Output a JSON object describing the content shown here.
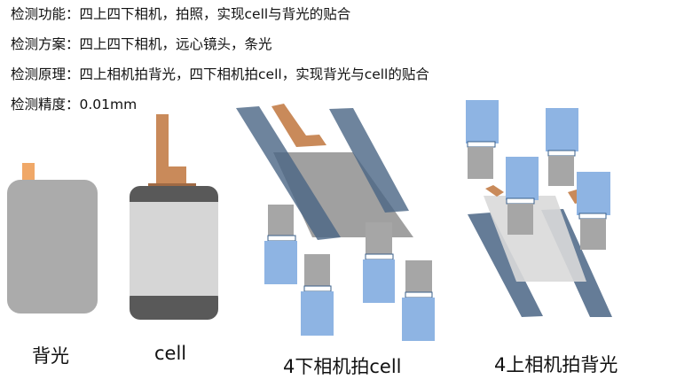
{
  "spec": {
    "lines": [
      {
        "label": "检测功能：",
        "value": "四上四下相机，拍照，实现cell与背光的贴合"
      },
      {
        "label": "检测方案：",
        "value": "四上四下相机，远心镜头，条光"
      },
      {
        "label": "检测原理：",
        "value": "四上相机拍背光，四下相机拍cell，实现背光与cell的贴合"
      },
      {
        "label": "检测精度：",
        "value": "0.01mm"
      }
    ]
  },
  "captions": {
    "backlight": "背光",
    "cell": "cell",
    "lower_cameras": "4下相机拍cell",
    "upper_cameras": "4上相机拍背光"
  },
  "colors": {
    "backlight_gray": "#ababab",
    "cell_body": "#d6d6d6",
    "cell_cap": "#595959",
    "fpc_orange": "#c98a5a",
    "tab_orange": "#f0a868",
    "camera_body": "#a6a6a6",
    "lens_blue": "#8eb4e3",
    "slab_blue": "#4a6585"
  },
  "icons": {
    "camera": "camera-icon",
    "light_bar": "light-bar-icon"
  }
}
